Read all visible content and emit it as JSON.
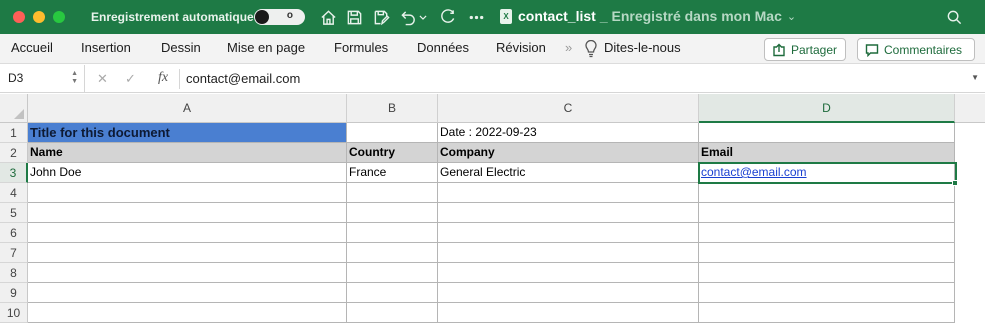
{
  "titlebar": {
    "autosave_label": "Enregistrement automatique",
    "autosave_state": "o",
    "document_name": "contact_list",
    "document_status": "_ Enregistré dans mon Mac",
    "icons": [
      "home-icon",
      "save-icon",
      "save-as-icon",
      "undo-icon",
      "redo-icon",
      "more-icon",
      "search-icon"
    ],
    "accent_color": "#1e7a45"
  },
  "ribbon": {
    "tabs": [
      "Accueil",
      "Insertion",
      "Dessin",
      "Mise en page",
      "Formules",
      "Données",
      "Révision"
    ],
    "overflow": "»",
    "tell_me": "Dites-le-nous",
    "share_label": "Partager",
    "comments_label": "Commentaires"
  },
  "formula_bar": {
    "name_box": "D3",
    "cancel": "✕",
    "confirm": "✓",
    "fx": "fx",
    "value": "contact@email.com"
  },
  "sheet": {
    "columns": [
      "A",
      "B",
      "C",
      "D"
    ],
    "rows": [
      "1",
      "2",
      "3",
      "4",
      "5",
      "6",
      "7",
      "8",
      "9",
      "10"
    ],
    "active_cell": "D3",
    "cells": {
      "A1": "Title for this document",
      "C1": "Date : 2022-09-23",
      "A2": "Name",
      "B2": "Country",
      "C2": "Company",
      "D2": "Email",
      "A3": "John Doe",
      "B3": "France",
      "C3": "General Electric",
      "D3": "contact@email.com"
    },
    "colors": {
      "title_fill": "#4a7fd1",
      "header_fill": "#d4d4d4",
      "link": "#1a3fd1"
    }
  }
}
